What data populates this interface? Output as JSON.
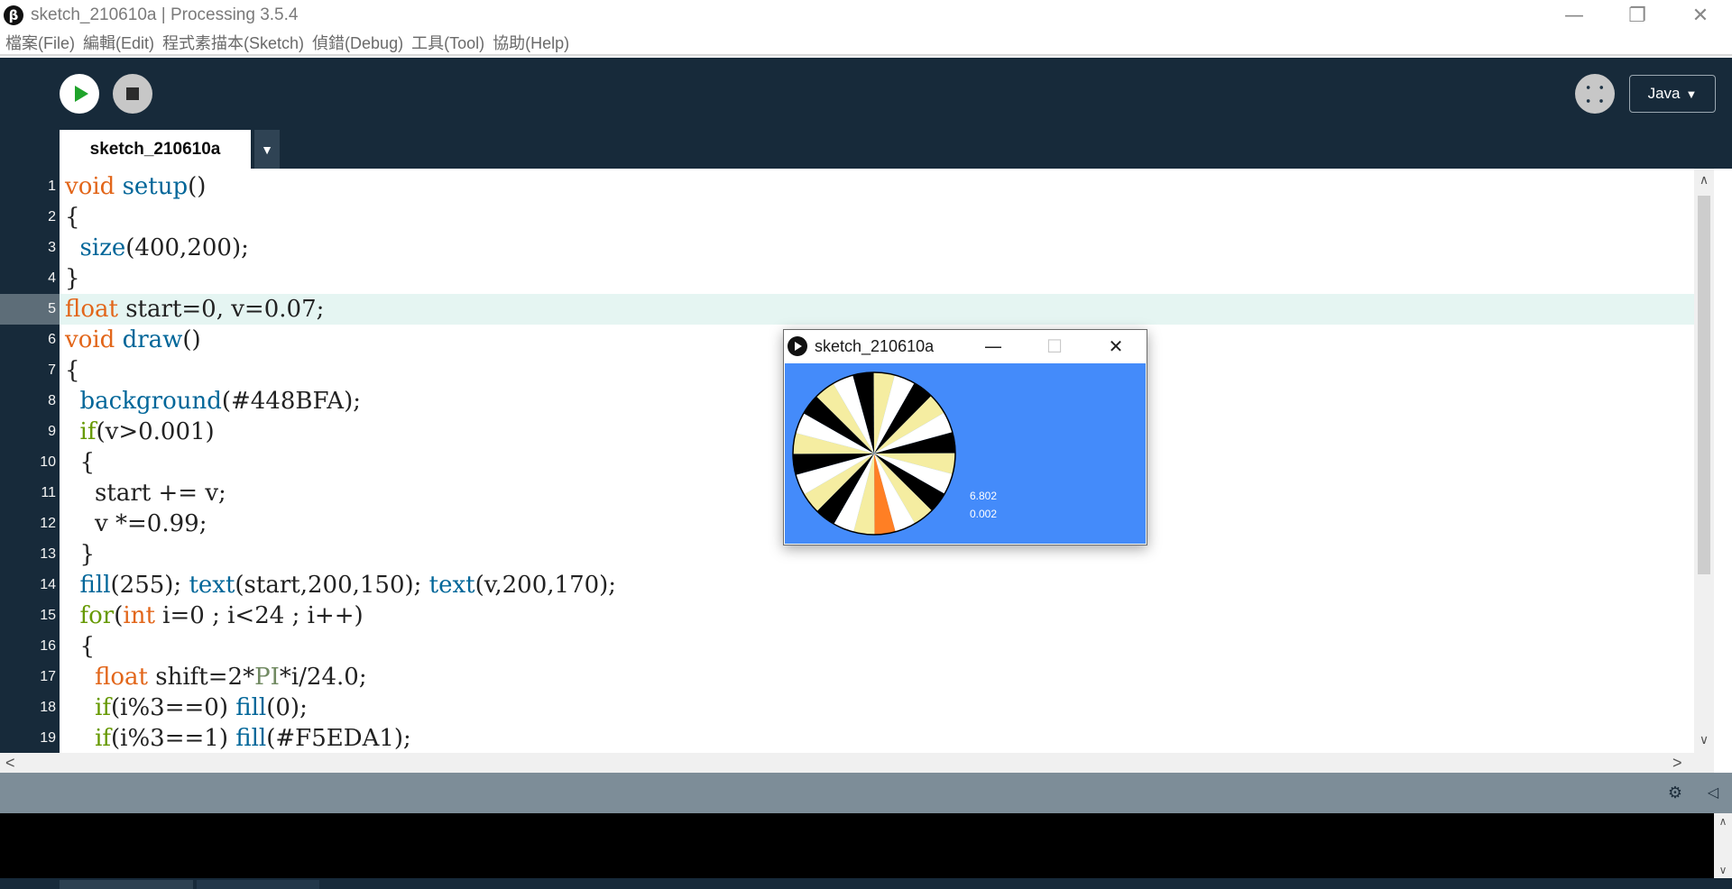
{
  "window": {
    "title": "sketch_210610a | Processing 3.5.4",
    "app_icon_glyph": "β",
    "minimize_glyph": "—",
    "restore_glyph": "❐",
    "close_glyph": "✕"
  },
  "menu": [
    "檔案(File)",
    "編輯(Edit)",
    "程式素描本(Sketch)",
    "偵錯(Debug)",
    "工具(Tool)",
    "協助(Help)"
  ],
  "toolbar": {
    "run_icon": "play-icon",
    "stop_icon": "stop-icon",
    "debug_icon": "butterfly-icon",
    "debug_glyph": "⸬",
    "mode_label": "Java",
    "mode_arrow": "▼"
  },
  "tab": {
    "name": "sketch_210610a",
    "dropdown_glyph": "▼"
  },
  "editor": {
    "current_line": 5,
    "lines": [
      {
        "n": "1",
        "tokens": [
          {
            "t": "void",
            "c": "kw"
          },
          {
            "t": " "
          },
          {
            "t": "setup",
            "c": "fn"
          },
          {
            "t": "()"
          }
        ]
      },
      {
        "n": "2",
        "tokens": [
          {
            "t": "{"
          }
        ]
      },
      {
        "n": "3",
        "tokens": [
          {
            "t": "  "
          },
          {
            "t": "size",
            "c": "fn"
          },
          {
            "t": "(400,200);"
          }
        ]
      },
      {
        "n": "4",
        "tokens": [
          {
            "t": "}"
          }
        ]
      },
      {
        "n": "5",
        "tokens": [
          {
            "t": "float",
            "c": "kw"
          },
          {
            "t": " start=0, v=0.07;"
          }
        ]
      },
      {
        "n": "6",
        "tokens": [
          {
            "t": "void",
            "c": "kw"
          },
          {
            "t": " "
          },
          {
            "t": "draw",
            "c": "fn"
          },
          {
            "t": "()"
          }
        ]
      },
      {
        "n": "7",
        "tokens": [
          {
            "t": "{"
          }
        ]
      },
      {
        "n": "8",
        "tokens": [
          {
            "t": "  "
          },
          {
            "t": "background",
            "c": "fn"
          },
          {
            "t": "(#448BFA);"
          }
        ]
      },
      {
        "n": "9",
        "tokens": [
          {
            "t": "  "
          },
          {
            "t": "if",
            "c": "ctl"
          },
          {
            "t": "(v>0.001)"
          }
        ]
      },
      {
        "n": "10",
        "tokens": [
          {
            "t": "  {"
          }
        ]
      },
      {
        "n": "11",
        "tokens": [
          {
            "t": "    start += v;"
          }
        ]
      },
      {
        "n": "12",
        "tokens": [
          {
            "t": "    v *=0.99;"
          }
        ]
      },
      {
        "n": "13",
        "tokens": [
          {
            "t": "  }"
          }
        ]
      },
      {
        "n": "14",
        "tokens": [
          {
            "t": "  "
          },
          {
            "t": "fill",
            "c": "fn"
          },
          {
            "t": "(255); "
          },
          {
            "t": "text",
            "c": "fn"
          },
          {
            "t": "(start,200,150); "
          },
          {
            "t": "text",
            "c": "fn"
          },
          {
            "t": "(v,200,170);"
          }
        ]
      },
      {
        "n": "15",
        "tokens": [
          {
            "t": "  "
          },
          {
            "t": "for",
            "c": "ctl"
          },
          {
            "t": "("
          },
          {
            "t": "int",
            "c": "kw"
          },
          {
            "t": " i=0 ; i<24 ; i++)"
          }
        ]
      },
      {
        "n": "16",
        "tokens": [
          {
            "t": "  {"
          }
        ]
      },
      {
        "n": "17",
        "tokens": [
          {
            "t": "    "
          },
          {
            "t": "float",
            "c": "kw"
          },
          {
            "t": " shift=2*"
          },
          {
            "t": "PI",
            "c": "cst"
          },
          {
            "t": "*i/24.0;"
          }
        ]
      },
      {
        "n": "18",
        "tokens": [
          {
            "t": "    "
          },
          {
            "t": "if",
            "c": "ctl"
          },
          {
            "t": "(i%3==0) "
          },
          {
            "t": "fill",
            "c": "fn"
          },
          {
            "t": "(0);"
          }
        ]
      },
      {
        "n": "19",
        "tokens": [
          {
            "t": "    "
          },
          {
            "t": "if",
            "c": "ctl"
          },
          {
            "t": "(i%3==1) "
          },
          {
            "t": "fill",
            "c": "fn"
          },
          {
            "t": "(#F5EDA1);"
          }
        ]
      }
    ]
  },
  "scroll": {
    "up_glyph": "∧",
    "down_glyph": "∨",
    "left_glyph": "<",
    "right_glyph": ">"
  },
  "status": {
    "icon_a": "console-settings-icon",
    "icon_a_glyph": "⚙",
    "icon_b": "collapse-icon",
    "icon_b_glyph": "◁"
  },
  "sketch_window": {
    "title": "sketch_210610a",
    "minimize_glyph": "—",
    "maximize_glyph": "☐",
    "close_glyph": "✕",
    "background_color": "#448BFA",
    "wheel": {
      "segments": 24,
      "start_angle_rad": 6.802,
      "colors": [
        "#000000",
        "#F5EDA1",
        "#FFFFFF"
      ],
      "highlight_color": "#FF7F24",
      "highlight_index": 3
    },
    "text_start": "6.802",
    "text_v": "0.002"
  }
}
